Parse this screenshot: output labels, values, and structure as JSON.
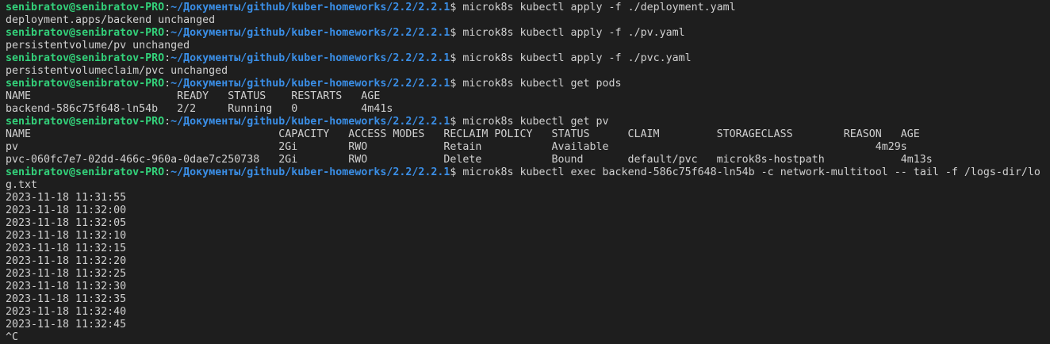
{
  "terminal": {
    "lines": [
      {
        "type": "prompt",
        "user": "senibratov@senibratov-PRO",
        "path": "~/Документы/github/kuber-homeworks/2.2/2.2.1",
        "cmd": " microk8s kubectl apply -f ./deployment.yaml"
      },
      {
        "type": "out",
        "text": "deployment.apps/backend unchanged"
      },
      {
        "type": "prompt",
        "user": "senibratov@senibratov-PRO",
        "path": "~/Документы/github/kuber-homeworks/2.2/2.2.1",
        "cmd": " microk8s kubectl apply -f ./pv.yaml"
      },
      {
        "type": "out",
        "text": "persistentvolume/pv unchanged"
      },
      {
        "type": "prompt",
        "user": "senibratov@senibratov-PRO",
        "path": "~/Документы/github/kuber-homeworks/2.2/2.2.1",
        "cmd": " microk8s kubectl apply -f ./pvc.yaml"
      },
      {
        "type": "out",
        "text": "persistentvolumeclaim/pvc unchanged"
      },
      {
        "type": "prompt",
        "user": "senibratov@senibratov-PRO",
        "path": "~/Документы/github/kuber-homeworks/2.2/2.2.1",
        "cmd": " microk8s kubectl get pods"
      },
      {
        "type": "out",
        "text": "NAME                       READY   STATUS    RESTARTS   AGE"
      },
      {
        "type": "out",
        "text": "backend-586c75f648-ln54b   2/2     Running   0          4m41s"
      },
      {
        "type": "prompt",
        "user": "senibratov@senibratov-PRO",
        "path": "~/Документы/github/kuber-homeworks/2.2/2.2.1",
        "cmd": " microk8s kubectl get pv"
      },
      {
        "type": "out",
        "text": "NAME                                       CAPACITY   ACCESS MODES   RECLAIM POLICY   STATUS      CLAIM         STORAGECLASS        REASON   AGE"
      },
      {
        "type": "out",
        "text": "pv                                         2Gi        RWO            Retain           Available                                          4m29s"
      },
      {
        "type": "out",
        "text": "pvc-060fc7e7-02dd-466c-960a-0dae7c250738   2Gi        RWO            Delete           Bound       default/pvc   microk8s-hostpath            4m13s"
      },
      {
        "type": "prompt",
        "user": "senibratov@senibratov-PRO",
        "path": "~/Документы/github/kuber-homeworks/2.2/2.2.1",
        "cmd": " microk8s kubectl exec backend-586c75f648-ln54b -c network-multitool -- tail -f /logs-dir/lo"
      },
      {
        "type": "out",
        "text": "g.txt"
      },
      {
        "type": "out",
        "text": "2023-11-18 11:31:55"
      },
      {
        "type": "out",
        "text": "2023-11-18 11:32:00"
      },
      {
        "type": "out",
        "text": "2023-11-18 11:32:05"
      },
      {
        "type": "out",
        "text": "2023-11-18 11:32:10"
      },
      {
        "type": "out",
        "text": "2023-11-18 11:32:15"
      },
      {
        "type": "out",
        "text": "2023-11-18 11:32:20"
      },
      {
        "type": "out",
        "text": "2023-11-18 11:32:25"
      },
      {
        "type": "out",
        "text": "2023-11-18 11:32:30"
      },
      {
        "type": "out",
        "text": "2023-11-18 11:32:35"
      },
      {
        "type": "out",
        "text": "2023-11-18 11:32:40"
      },
      {
        "type": "out",
        "text": "2023-11-18 11:32:45"
      },
      {
        "type": "out",
        "text": "^C"
      }
    ],
    "colon": ":",
    "dollar": "$",
    "colors": {
      "background": "#1e1e1e",
      "text": "#d0d0d0",
      "user": "#33d17a",
      "path": "#3a8ee6"
    }
  }
}
